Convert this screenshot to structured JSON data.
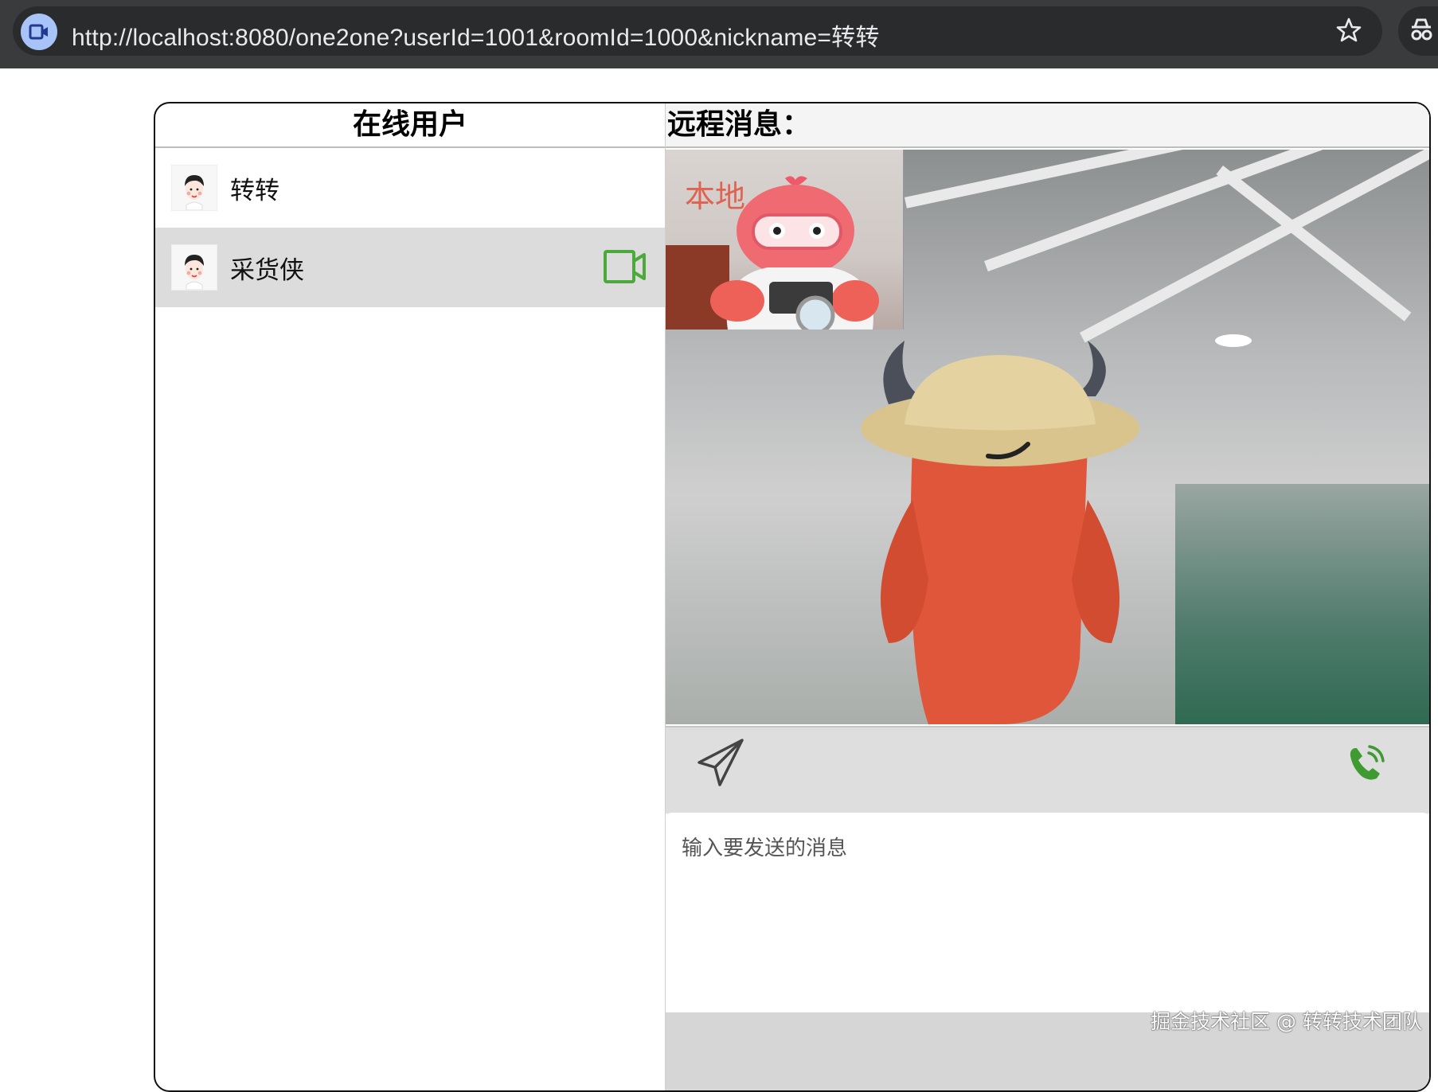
{
  "browser": {
    "url": "http://localhost:8080/one2one?userId=1001&roomId=1000&nickname=转转"
  },
  "online_users": {
    "title": "在线用户",
    "users": [
      {
        "name": "转转",
        "active": false,
        "has_video_call": false
      },
      {
        "name": "采货侠",
        "active": true,
        "has_video_call": true
      }
    ]
  },
  "remote": {
    "title": "远程消息：",
    "local_video_label": "本地"
  },
  "composer": {
    "placeholder": "输入要发送的消息"
  },
  "watermark": "掘金技术社区 @ 转转技术团队",
  "colors": {
    "accent_green": "#4caa3c",
    "active_row": "#dcdcdc",
    "local_label": "#e0503c"
  },
  "icons": [
    "video-camera-icon",
    "send-icon",
    "phone-icon",
    "star-icon",
    "incognito-icon",
    "avatar"
  ]
}
